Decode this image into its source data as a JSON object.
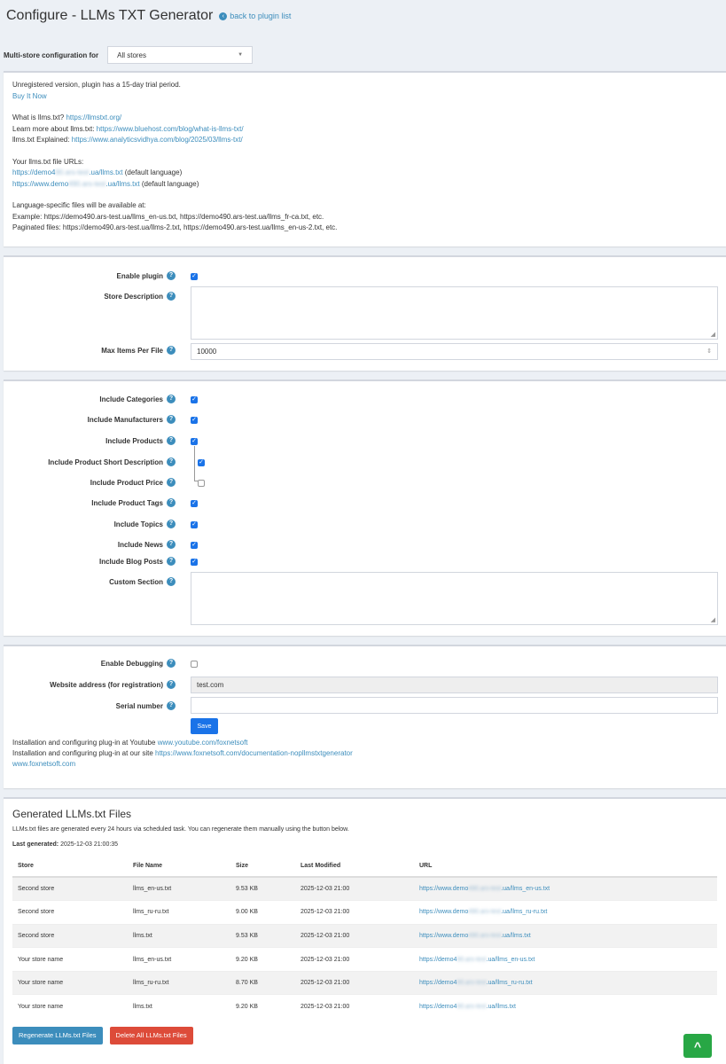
{
  "header": {
    "title": "Configure - LLMs TXT Generator",
    "back_link": "back to plugin list"
  },
  "multistore": {
    "label": "Multi-store configuration for",
    "value": "All stores"
  },
  "info": {
    "unregistered": "Unregistered version, plugin has a 15-day trial period.",
    "buy": "Buy It Now",
    "what_label": "What is llms.txt?",
    "what_url": "https://llmstxt.org/",
    "learn_label": "Learn more about llms.txt:",
    "learn_url": "https://www.bluehost.com/blog/what-is-llms-txt/",
    "explained_label": "llms.txt Explained:",
    "explained_url": "https://www.analyticsvidhya.com/blog/2025/03/llms-txt/",
    "urls_label": "Your llms.txt file URLs:",
    "url1_start": "https://demo4",
    "url1_blur": "90.ars-test",
    "url1_end": ".ua/llms.txt",
    "url1_note": "(default language)",
    "url2_start": "https://www.demo",
    "url2_blur": "490.ars-test",
    "url2_end": ".ua/llms.txt",
    "url2_note": "(default language)",
    "lang_label": "Language-specific files will be available at:",
    "example": "Example: https://demo490.ars-test.ua/llms_en-us.txt, https://demo490.ars-test.ua/llms_fr-ca.txt, etc.",
    "paginated": "Paginated files: https://demo490.ars-test.ua/llms-2.txt, https://demo490.ars-test.ua/llms_en-us-2.txt, etc."
  },
  "settings": {
    "enable_plugin": "Enable plugin",
    "store_description": "Store Description",
    "max_items": "Max Items Per File",
    "max_items_value": "10000",
    "include_categories": "Include Categories",
    "include_manufacturers": "Include Manufacturers",
    "include_products": "Include Products",
    "include_short_desc": "Include Product Short Description",
    "include_price": "Include Product Price",
    "include_tags": "Include Product Tags",
    "include_topics": "Include Topics",
    "include_news": "Include News",
    "include_blog": "Include Blog Posts",
    "custom_section": "Custom Section",
    "enable_debugging": "Enable Debugging",
    "website_label": "Website address (for registration)",
    "website_value": "test.com",
    "serial_label": "Serial number",
    "save": "Save",
    "yt_text": "Installation and configuring plug-in at Youtube",
    "yt_url": "www.youtube.com/foxnetsoft",
    "site_text": "Installation and configuring plug-in at our site",
    "site_url": "https://www.foxnetsoft.com/documentation-nopllmstxtgenerator",
    "foxnet": "www.foxnetsoft.com"
  },
  "generated": {
    "title": "Generated LLMs.txt Files",
    "desc": "LLMs.txt files are generated every 24 hours via scheduled task. You can regenerate them manually using the button below.",
    "last_label": "Last generated:",
    "last_value": "2025-12-03 21:00:35",
    "columns": [
      "Store",
      "File Name",
      "Size",
      "Last Modified",
      "URL"
    ],
    "rows": [
      [
        "Second store",
        "llms_en-us.txt",
        "9.53 KB",
        "2025-12-03 21:00"
      ],
      [
        "Second store",
        "llms_ru-ru.txt",
        "9.00 KB",
        "2025-12-03 21:00"
      ],
      [
        "Second store",
        "llms.txt",
        "9.53 KB",
        "2025-12-03 21:00"
      ],
      [
        "Your store name",
        "llms_en-us.txt",
        "9.20 KB",
        "2025-12-03 21:00"
      ],
      [
        "Your store name",
        "llms_ru-ru.txt",
        "8.70 KB",
        "2025-12-03 21:00"
      ],
      [
        "Your store name",
        "llms.txt",
        "9.20 KB",
        "2025-12-03 21:00"
      ]
    ],
    "urls": [
      [
        "https://www.demo",
        "490.ars-test",
        ".ua/llms_en-us.txt"
      ],
      [
        "https://www.demo",
        "490.ars-test",
        ".ua/llms_ru-ru.txt"
      ],
      [
        "https://www.demo",
        "490.ars-test",
        ".ua/llms.txt"
      ],
      [
        "https://demo4",
        "90.ars-test",
        ".ua/llms_en-us.txt"
      ],
      [
        "https://demo4",
        "90.ars-test",
        ".ua/llms_ru-ru.txt"
      ],
      [
        "https://demo4",
        "90.ars-test",
        ".ua/llms.txt"
      ]
    ],
    "regenerate": "Regenerate LLMs.txt Files",
    "delete": "Delete All LLMs.txt Files"
  },
  "scrolltop": "^"
}
